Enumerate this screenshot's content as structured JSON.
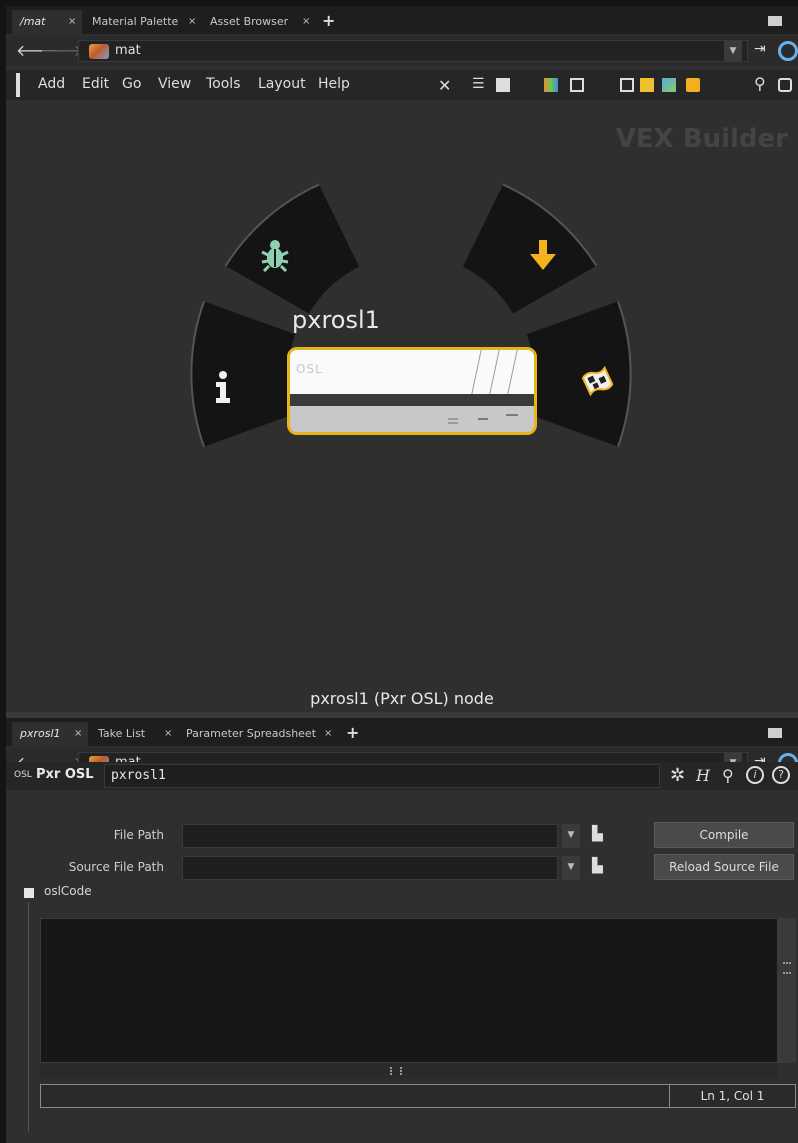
{
  "top_pane": {
    "tabs": [
      {
        "label": "/mat"
      },
      {
        "label": "Material Palette"
      },
      {
        "label": "Asset Browser"
      }
    ],
    "path": {
      "label": "mat"
    },
    "menu": [
      "Add",
      "Edit",
      "Go",
      "View",
      "Tools",
      "Layout",
      "Help"
    ],
    "watermark": "VEX Builder",
    "node": {
      "name": "pxrosl1",
      "type_badge": "OSL",
      "caption": "pxrosl1 (Pxr OSL) node"
    }
  },
  "bottom_pane": {
    "tabs": [
      {
        "label": "pxrosl1"
      },
      {
        "label": "Take List"
      },
      {
        "label": "Parameter Spreadsheet"
      }
    ],
    "path": {
      "label": "mat"
    },
    "header": {
      "badge": "OSL",
      "type": "Pxr OSL",
      "node_name": "pxrosl1"
    },
    "params": {
      "file_path_label": "File Path",
      "file_path_value": "",
      "source_file_path_label": "Source File Path",
      "source_file_path_value": "",
      "compile_label": "Compile",
      "reload_label": "Reload Source File",
      "section_label": "oslCode"
    },
    "status": {
      "cursor": "Ln 1, Col 1"
    }
  },
  "colors": {
    "selection": "#e8b21a",
    "ring_segment": "#141414",
    "bug_icon": "#8fd0b0",
    "arrow_icon": "#f2b31c"
  },
  "icons": [
    "back-arrow-icon",
    "forward-arrow-icon",
    "pin-icon",
    "ring-icon",
    "bug-icon",
    "info-icon",
    "down-arrow-icon",
    "flag-icon",
    "gear-icon",
    "search-icon"
  ]
}
